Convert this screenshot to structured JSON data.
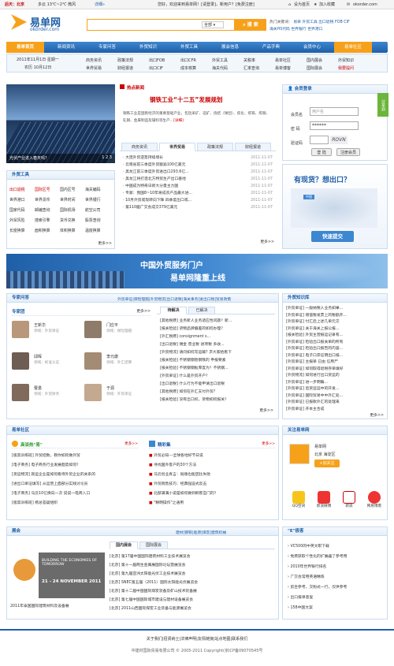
{
  "topbar": {
    "city": "后天：北京",
    "weather": "多云 13℃~2℃ 微风",
    "detail": "详细»",
    "welcome": "您好，欢迎来到易单网！[请登录]，新用户？[免费注册]",
    "set_home": "设为首页",
    "favorite": "加入收藏",
    "domain": "okorder.com"
  },
  "logo": {
    "cn": "易单网",
    "en": "okorder.com"
  },
  "search": {
    "option": "全部",
    "button": "搜 索",
    "placeholder": ""
  },
  "hot": {
    "label": "热门关键词：",
    "items": [
      "易单",
      "外贸工具",
      "出口退税",
      "FOB",
      "CIF",
      "海关HS代码",
      "世界银行",
      "世界港口"
    ]
  },
  "nav": [
    "易单首页",
    "新闻资讯",
    "专家问答",
    "外贸知识",
    "外贸工具",
    "展会信息",
    "产品字典",
    "会员中心",
    "易单社区"
  ],
  "subnav": {
    "date": "2011年11月1日 星期一",
    "lunar": "农历 10月12日",
    "links": [
      "商务资讯",
      "世界贸易",
      "政策法规",
      "财经报道",
      "出口FOB",
      "出口CIF",
      "出口CFR",
      "成本核算",
      "外贸工具",
      "海关代码",
      "关税率",
      "汇率查询",
      "易单社区",
      "易单博客",
      "国内展会",
      "国际展会",
      "外贸知识",
      "我要提问"
    ]
  },
  "banner": {
    "caption": "光伏产业进入春天吗？",
    "pager": "1 2 3"
  },
  "news": {
    "tag": "热点新闻",
    "headline": "钢铁工业“十二五”发展规划",
    "summary": "钢铁工业是国民经济的重要基础产业，包括采矿、选矿、烧结（球团）、焦化、炼铁、炼钢、轧钢、金属制品及辅料等生产...",
    "more": "[详细]",
    "tabs": [
      "商务资讯",
      "世界贸易",
      "政策法规",
      "财经报道"
    ],
    "items": [
      {
        "t": "大连外贸逆势持续增长",
        "d": "2011-11-07"
      },
      {
        "t": "云南省前三季度外贸额逾100亿美元",
        "d": "2011-11-07"
      },
      {
        "t": "黑龙江前三季度外贸进出口293.6亿...",
        "d": "2011-11-07"
      },
      {
        "t": "黑龙江将打造北方特贸生产出口基地",
        "d": "2011-11-07"
      },
      {
        "t": "中国成为特奇日新大分量主力国",
        "d": "2011-11-07"
      },
      {
        "t": "专家：我国8~10年将成农产品最大进...",
        "d": "2011-11-07"
      },
      {
        "t": "10月外贸或现转向下降 四季度出口或...",
        "d": "2011-11-07"
      },
      {
        "t": "第110届广交会成交379亿美元",
        "d": "2011-11-07"
      }
    ],
    "more2": "更多>>"
  },
  "login": {
    "title": "会员登录",
    "user_label": "会员名",
    "user_ph": "用户名",
    "pwd_label": "密 码",
    "pwd_value": "******",
    "code_label": "验证码",
    "code_img": "ROVN",
    "login": "登 陆",
    "register": "注册会员"
  },
  "goods": {
    "q": "有现货？想出口？",
    "country": "中国",
    "btn": "快速提交"
  },
  "tools": {
    "title": "外贸工具",
    "rows": [
      [
        "出口退税",
        "国际区号",
        "国内区号",
        "海关编码"
      ],
      [
        "世界港口",
        "世界货币",
        "世界时间",
        "世界银行"
      ],
      [
        "国家代码",
        "邮编查询",
        "国际机场",
        "航空公司"
      ],
      [
        "外贸风险",
        "搜索引擎",
        "货币兑换",
        "股票查询"
      ],
      [
        "长度换算",
        "面积换算",
        "体积换算",
        "温度换算"
      ]
    ],
    "more": "更多>>"
  },
  "wide_banner": {
    "line1": "中国外贸服务门户",
    "line2": "易单网隆重上线"
  },
  "expert": {
    "title": "专家问答",
    "links": [
      "外贸单证",
      "保险理赔",
      "外贸物流",
      "出口退税",
      "海关事务",
      "进出口税",
      "贸易政策"
    ],
    "group": "专家团",
    "more": "更多>>",
    "people": [
      {
        "name": "王新华",
        "field": "领域：外贸单证"
      },
      {
        "name": "门应平",
        "field": "领域：保险理赔"
      },
      {
        "name": "邱晖",
        "field": "领域：标准认证"
      },
      {
        "name": "李元康",
        "field": "领域：外汇结算"
      },
      {
        "name": "曹勇",
        "field": "领域：外贸财务"
      },
      {
        "name": "于源",
        "field": "领域：外贸单证"
      }
    ],
    "tabs": [
      "待解决",
      "已解决"
    ],
    "qs": [
      "[其他税费] 业务新人业务适应性问题？新...",
      "[报关检验] 货物品牌偏差的如何办理？",
      "[外汇税费] consignment s...",
      "[出口退税] 佣金 营业税 进项税 多收...",
      "[外贸物流] 请问如何写运输? 求大家给看下",
      "[报关检验] 不锈钢钢管钢铁的 申报要素",
      "[报关检验] 不锈钢钢板厚度为？不锈钢...",
      "[外贸单证] 什么是外贸开户？",
      "[出口退税] 什么行为不能申请出口退税",
      "[其他税费] 如何在外汇支付外贸?",
      "[报关检验] 没有出口权，货物如何报关？"
    ],
    "more2": "更多>>"
  },
  "knowledge": {
    "title": "外贸知识库",
    "items": [
      "[外贸单证] 一般纳税人业务如果...",
      "[外贸单证] 增值税发票上的税额开...",
      "[外贸单证] 付汇后上述几单元交",
      "[外贸单证] 关于海关上报公报...",
      "[报关检验] 外贸主营报运记录有...",
      "[外贸单证] 检验出口报关单的所有",
      "[外贸单证] 检验出口报告的内容...",
      "[外贸单证] 电子口岸证明出口报...",
      "[外贸单证] 主报单 已由 信用尸",
      "[外贸单证] 如何取得退税存单填好",
      "[外贸物流] 如何进行出口货运的",
      "[外贸单证] 进一步明确...",
      "[外贸单证] 后货运运中的开发...",
      "[外贸单证] 国际贸易中中外汇处...",
      "[外贸单证] 已报款外汇的处理来",
      "[外贸单证] 开本主合成"
    ],
    "more": "更多>>"
  },
  "community": {
    "title": "易单社区",
    "left_tag": "高谈热\"易\"",
    "right_tag": "精彩集",
    "more": "更多>>",
    "left": [
      "[极其训练班] 外贸招数，教你如何做外贸",
      "[电子商务] 电子商务行业发展趋势如何？",
      "[货运物流] 就运企业是如何看待外贸企业的关系的",
      "[进出口单证填写] 从运营上面部分实践讨论员",
      "[电子商务] 马云10亿换向一次 说说一电商入口",
      "[极其训练班] 杨总答疑组织"
    ],
    "right": [
      "外贸必知---全球各地好节日说",
      "寻找国外客户的30个方法",
      "马云创业真言：很顺也能因比失败",
      "外贸销售技巧：经典强迫式反击",
      "北部满满小说是如何做到刷客宫门的？",
      "\"精明操作\"之通用"
    ]
  },
  "follow": {
    "title": "关注易单网",
    "name": "易单网",
    "location": "北京 海淀区",
    "btn": "+加关注",
    "platforms": [
      "QQ空间",
      "新浪微博",
      "新浪",
      "网易博客"
    ]
  },
  "expo": {
    "title": "展会",
    "cats": [
      "建材",
      "钢铁",
      "能源",
      "煤炭",
      "建筑机械"
    ],
    "tabs": [
      "国内展会",
      "国际展会"
    ],
    "poster": {
      "title": "BUILDING THE ECONOMIES OF TOMORROW",
      "date": "21 - 24 NOVEMBER 2011"
    },
    "caption": "2011年泰国国际建筑材料及设备展",
    "items": [
      "[北京] 第17届中国国际建筑材料工业技术展览会",
      "[北京] 第十一届两生金属展国际论坛暨展览会",
      "[北京] 第九届亚洲太阳能光伏工业技术展览会",
      "[北京] SNEC第五届（2011）国际太阳能光伏展览会",
      "[北京] 第十二届中国国际煤炭装备及矿山技术装备展",
      "[北京] 第七届中国国际城市建设与建材设备展览会",
      "[北京] 2011山西国际煤炭工业装备与能源展览会"
    ]
  },
  "e_board": {
    "title": "\"E\"极客",
    "items": [
      "VC500的中英文职下载",
      "免费获取个性化的扩展器了参考用",
      "2010年世界银行排名",
      "广交会常用英语精炼",
      "剪合参考，交粉式一行，仅供参考",
      "出口报单意复",
      "158中国文案"
    ]
  },
  "footer": {
    "links": [
      "关于我们",
      "招贤纳士",
      "法律声明",
      "友情链接",
      "站点地图",
      "联系我们"
    ],
    "copyright": "中建材国际贸易有限公司 © 2005-2011 Copyright(京ICP备09070545号"
  },
  "side_tab": "分享到"
}
